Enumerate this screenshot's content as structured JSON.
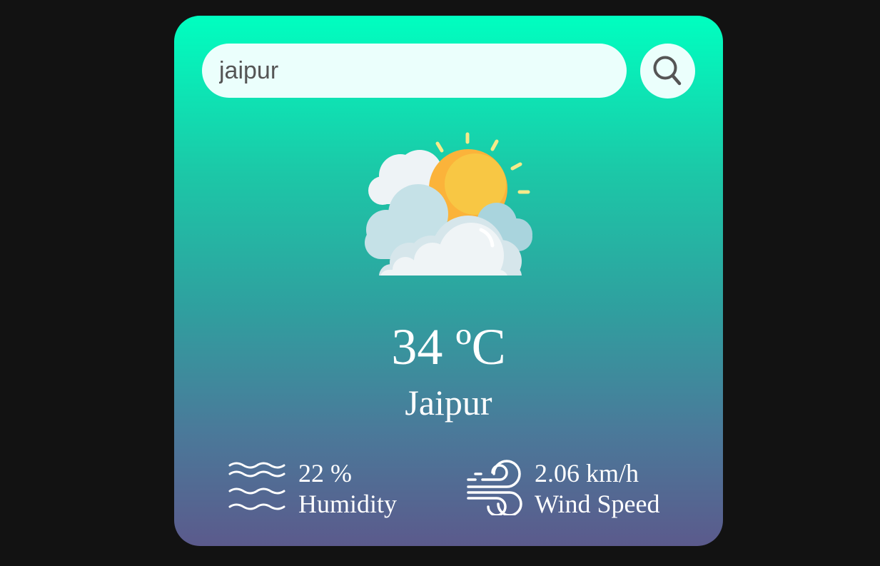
{
  "search": {
    "value": "jaipur",
    "placeholder": ""
  },
  "weather": {
    "icon": "partly-cloudy-icon",
    "temperature": "34 ºC",
    "city": "Jaipur"
  },
  "details": {
    "humidity": {
      "icon": "humidity-icon",
      "value": "22 %",
      "label": "Humidity"
    },
    "wind": {
      "icon": "wind-icon",
      "value": "2.06 km/h",
      "label": "Wind Speed"
    }
  },
  "colors": {
    "background": "#121212",
    "gradient_top": "#00ffc0",
    "gradient_bottom": "#5b5a8c",
    "input_bg": "#ebfffc",
    "text": "#ffffff"
  }
}
